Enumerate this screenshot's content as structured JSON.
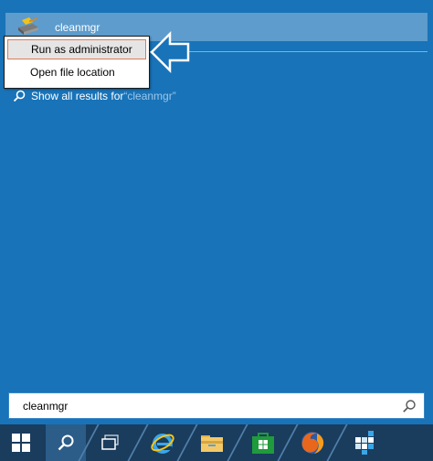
{
  "search_result": {
    "app_name": "cleanmgr",
    "icon": "disk-cleanup-icon"
  },
  "context_menu": {
    "items": [
      {
        "label": "Run as administrator",
        "highlighted": true
      },
      {
        "label": "Open file location",
        "highlighted": false
      }
    ]
  },
  "show_all": {
    "prefix": "Show all results for ",
    "query": "“cleanmgr”"
  },
  "search_box": {
    "value": "cleanmgr",
    "icon": "search-icon"
  },
  "taskbar": {
    "icons": [
      "windows-start-icon",
      "search-icon",
      "task-view-icon",
      "internet-explorer-icon",
      "file-explorer-icon",
      "store-icon",
      "firefox-icon",
      "puzzle-cube-icon"
    ]
  },
  "colors": {
    "background": "#1873b8",
    "result_highlight": "#5d9ccd",
    "menu_highlight_border": "#e07b52",
    "taskbar": "#1a3c5d"
  }
}
